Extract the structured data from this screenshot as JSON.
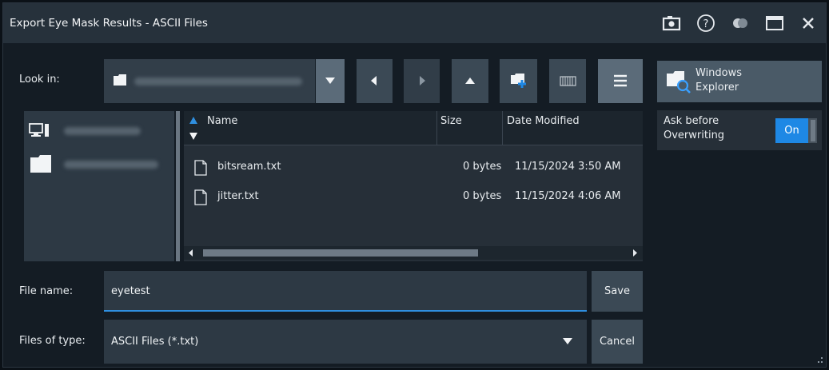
{
  "window": {
    "title": "Export Eye Mask Results - ASCII Files",
    "icons": [
      "camera-icon",
      "help-icon",
      "toggle-theme-icon",
      "maximize-icon",
      "close-icon"
    ],
    "help_glyph": "?"
  },
  "look_in": {
    "label": "Look in:",
    "path_visible": false
  },
  "toolbar": [
    "dropdown-arrow-icon",
    "back-icon",
    "forward-icon",
    "up-folder-icon",
    "new-folder-icon",
    "detail-view-icon",
    "list-view-icon"
  ],
  "places": {
    "items": [
      {
        "icon": "computer-icon"
      },
      {
        "icon": "folder-icon"
      }
    ]
  },
  "file_list": {
    "columns": [
      "Name",
      "Size",
      "Date Modified"
    ],
    "files": [
      {
        "name": "bitsream.txt",
        "size": "0 bytes",
        "modified": "11/15/2024 3:50 AM"
      },
      {
        "name": "jitter.txt",
        "size": "0 bytes",
        "modified": "11/15/2024 4:06 AM"
      }
    ]
  },
  "file_name": {
    "label": "File name:",
    "value": "eyetest"
  },
  "files_of_type": {
    "label": "Files of type:",
    "value": "ASCII Files (*.txt)"
  },
  "buttons": {
    "save": "Save",
    "cancel": "Cancel"
  },
  "windows_explorer": {
    "line1": "Windows",
    "line2": "Explorer"
  },
  "ask_overwrite": {
    "line1": "Ask before",
    "line2": "Overwriting",
    "state": "On"
  },
  "colors": {
    "accent": "#1e88e5",
    "background": "#141c24",
    "titlebar": "#26313b"
  }
}
